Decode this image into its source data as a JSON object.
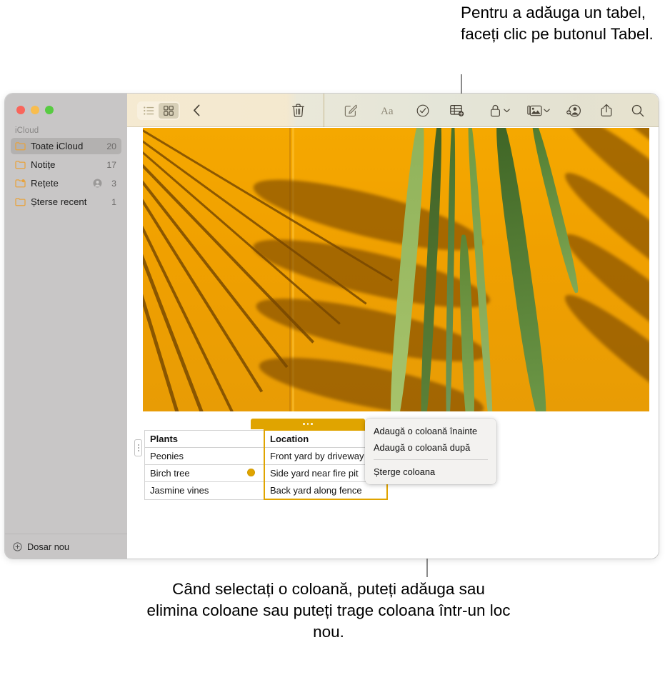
{
  "callouts": {
    "top": "Pentru a adăuga un tabel, faceți clic pe butonul Tabel.",
    "bottom": "Când selectați o coloană, puteți adăuga sau elimina coloane sau puteți trage coloana într-un loc nou."
  },
  "window": {
    "traffic_lights": [
      "close",
      "minimize",
      "zoom"
    ]
  },
  "sidebar": {
    "section_title": "iCloud",
    "items": [
      {
        "label": "Toate iCloud",
        "count": "20",
        "icon": "folder-icon",
        "selected": true,
        "shared": false
      },
      {
        "label": "Notițe",
        "count": "17",
        "icon": "folder-icon",
        "selected": false,
        "shared": false
      },
      {
        "label": "Rețete",
        "count": "3",
        "icon": "folder-shared-icon",
        "selected": false,
        "shared": true
      },
      {
        "label": "Șterse recent",
        "count": "1",
        "icon": "folder-icon",
        "selected": false,
        "shared": false
      }
    ],
    "new_folder_label": "Dosar nou"
  },
  "toolbar": {
    "view_list_icon": "list-view-icon",
    "view_grid_icon": "grid-view-icon",
    "back_icon": "chevron-left-icon",
    "delete_icon": "trash-icon",
    "compose_icon": "compose-icon",
    "format_icon": "format-text-icon",
    "checklist_icon": "checklist-icon",
    "table_icon": "add-table-icon",
    "lock_icon": "lock-icon",
    "media_icon": "media-icon",
    "share_person_icon": "add-person-icon",
    "share_icon": "share-icon",
    "search_icon": "search-icon"
  },
  "note": {
    "photo_alt": "palm-frond-shadow-on-orange-wall"
  },
  "table": {
    "accent": "#e0a400",
    "selected_column_index": 1,
    "columns": [
      "Plants",
      "Location"
    ],
    "rows": [
      [
        "Peonies",
        "Front yard by driveway"
      ],
      [
        "Birch tree",
        "Side yard near fire pit"
      ],
      [
        "Jasmine vines",
        "Back yard along fence"
      ]
    ]
  },
  "context_menu": {
    "items": [
      {
        "label": "Adaugă o coloană înainte",
        "separator_after": false
      },
      {
        "label": "Adaugă o coloană după",
        "separator_after": true
      },
      {
        "label": "Șterge coloana",
        "separator_after": false
      }
    ]
  }
}
